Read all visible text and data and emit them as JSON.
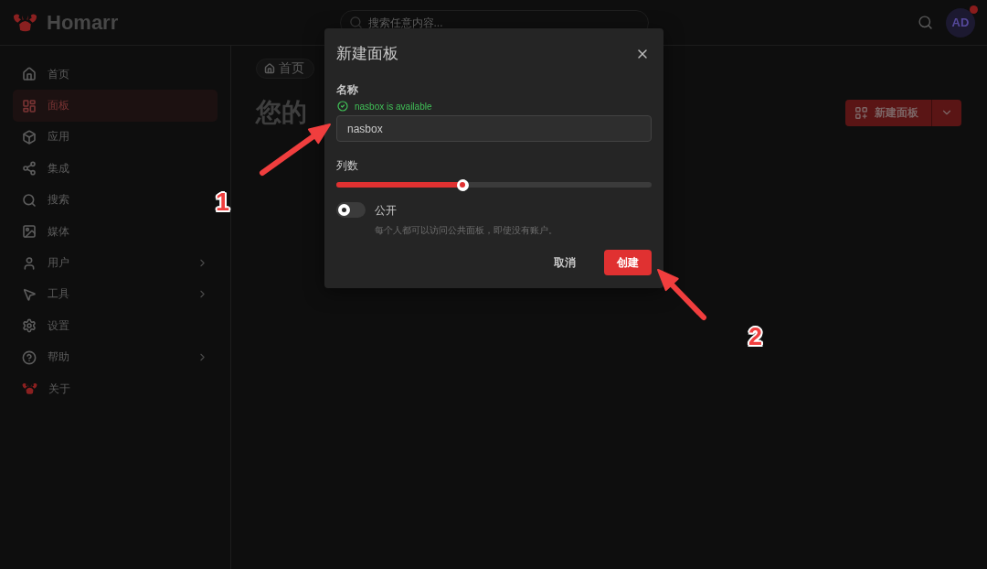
{
  "header": {
    "logo_text": "Homarr",
    "search": {
      "placeholder": "搜索任意内容..."
    },
    "avatar": {
      "initials": "AD",
      "notification": true
    }
  },
  "sidebar": {
    "items": [
      {
        "label": "首页",
        "selected": false,
        "has_submenu": false
      },
      {
        "label": "面板",
        "selected": true,
        "has_submenu": false
      },
      {
        "label": "应用",
        "selected": false,
        "has_submenu": false
      },
      {
        "label": "集成",
        "selected": false,
        "has_submenu": false
      },
      {
        "label": "搜索",
        "selected": false,
        "has_submenu": false
      },
      {
        "label": "媒体",
        "selected": false,
        "has_submenu": false
      },
      {
        "label": "用户",
        "selected": false,
        "has_submenu": true
      },
      {
        "label": "工具",
        "selected": false,
        "has_submenu": true
      },
      {
        "label": "设置",
        "selected": false,
        "has_submenu": false
      },
      {
        "label": "帮助",
        "selected": false,
        "has_submenu": true
      },
      {
        "label": "关于",
        "selected": false,
        "has_submenu": false
      }
    ]
  },
  "main": {
    "breadcrumb": [
      {
        "label": "首页"
      }
    ],
    "title": "您的",
    "new_board_button": {
      "label": "新建面板"
    }
  },
  "dialog": {
    "title": "新建面板",
    "name_field": {
      "label": "名称",
      "status": "nasbox is available",
      "value": "nasbox"
    },
    "columns_slider": {
      "label": "列数",
      "level": 0.4
    },
    "public_toggle": {
      "label": "公开",
      "description": "每个人都可以访问公共面板，即使没有账户。",
      "on": false
    },
    "buttons": [
      {
        "label": "取消",
        "kind": "secondary"
      },
      {
        "label": "创建",
        "kind": "primary"
      }
    ]
  },
  "annotations": [
    {
      "label": "1"
    },
    {
      "label": "2"
    }
  ]
}
